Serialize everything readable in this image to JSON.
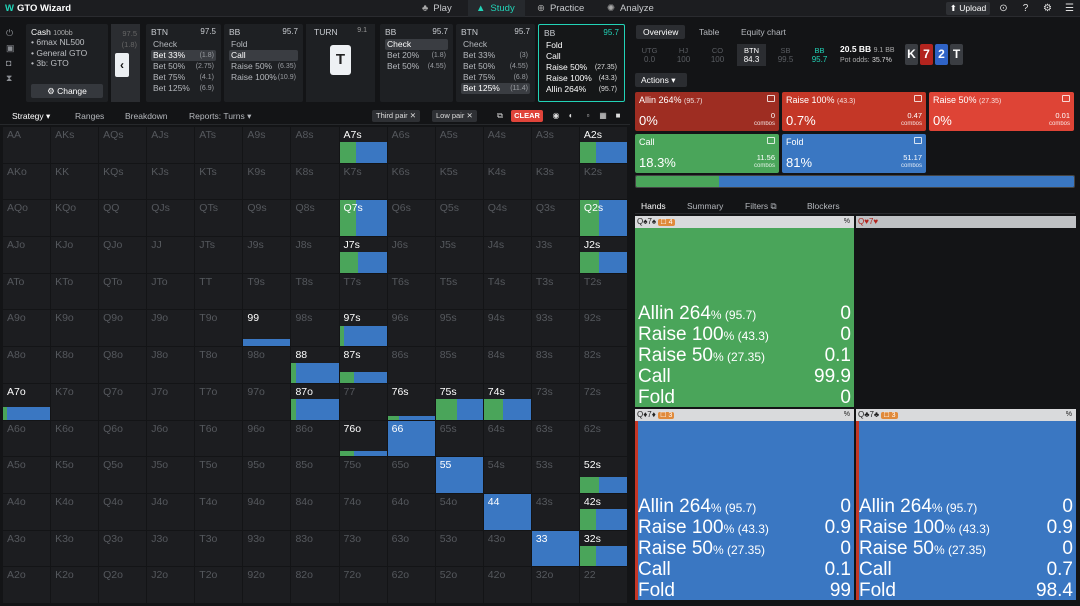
{
  "app": {
    "logo": "GTO Wizard",
    "nav": [
      "Play",
      "Study",
      "Practice",
      "Analyze"
    ],
    "active_nav": "Study",
    "upload": "Upload"
  },
  "colors": {
    "green": "#4aa55a",
    "blue": "#3a77c2",
    "red_dark": "#9e2d22",
    "red": "#c43727",
    "red_bright": "#de4436",
    "accent": "#22d3b7"
  },
  "sidebar": {
    "icons": [
      "power-icon",
      "save-icon",
      "gamepad-icon",
      "hourglass-icon"
    ]
  },
  "cash": {
    "title": "Cash",
    "stake": "100bb",
    "items": [
      "6max NL500",
      "General GTO",
      "3b: GTO"
    ],
    "change": "Change"
  },
  "prev_node": {
    "value": "97.5",
    "sub": "(1.8)"
  },
  "nodes": [
    {
      "pos": "BTN",
      "stack": "97.5",
      "actions": [
        {
          "n": "Check",
          "s": ""
        },
        {
          "n": "Bet 33%",
          "s": "(1.8)",
          "sel": true
        },
        {
          "n": "Bet 50%",
          "s": "(2.75)"
        },
        {
          "n": "Bet 75%",
          "s": "(4.1)"
        },
        {
          "n": "Bet 125%",
          "s": "(6.9)"
        }
      ]
    },
    {
      "pos": "BB",
      "stack": "95.7",
      "actions": [
        {
          "n": "Fold",
          "s": ""
        },
        {
          "n": "Call",
          "s": "",
          "sel": true
        },
        {
          "n": "Raise 50%",
          "s": "(6.35)"
        },
        {
          "n": "Raise 100%",
          "s": "(10.9)"
        }
      ]
    },
    {
      "pos": "BB",
      "stack": "95.7",
      "actions": [
        {
          "n": "Check",
          "s": "",
          "sel": true
        },
        {
          "n": "Bet 20%",
          "s": "(1.8)"
        },
        {
          "n": "Bet 50%",
          "s": "(4.55)"
        }
      ]
    },
    {
      "pos": "BTN",
      "stack": "95.7",
      "actions": [
        {
          "n": "Check",
          "s": ""
        },
        {
          "n": "Bet 33%",
          "s": "(3)"
        },
        {
          "n": "Bet 50%",
          "s": "(4.55)"
        },
        {
          "n": "Bet 75%",
          "s": "(6.8)"
        },
        {
          "n": "Bet 125%",
          "s": "(11.4)",
          "sel": true
        }
      ]
    },
    {
      "pos": "BB",
      "stack": "95.7",
      "active": true,
      "actions": [
        {
          "n": "Fold",
          "s": ""
        },
        {
          "n": "Call",
          "s": ""
        },
        {
          "n": "Raise 50%",
          "s": "(27.35)"
        },
        {
          "n": "Raise 100%",
          "s": "(43.3)"
        },
        {
          "n": "Allin 264%",
          "s": "(95.7)"
        }
      ]
    }
  ],
  "turn": {
    "label": "TURN",
    "value": "9.1",
    "card": "T"
  },
  "subtabs": [
    "Strategy",
    "Ranges",
    "Breakdown",
    "Reports: Turns"
  ],
  "filters": [
    "Third pair",
    "Low pair"
  ],
  "clear": "CLEAR",
  "matrix": {
    "labels": [
      [
        "AA",
        "AKs",
        "AQs",
        "AJs",
        "ATs",
        "A9s",
        "A8s",
        "A7s",
        "A6s",
        "A5s",
        "A4s",
        "A3s",
        "A2s"
      ],
      [
        "AKo",
        "KK",
        "KQs",
        "KJs",
        "KTs",
        "K9s",
        "K8s",
        "K7s",
        "K6s",
        "K5s",
        "K4s",
        "K3s",
        "K2s"
      ],
      [
        "AQo",
        "KQo",
        "QQ",
        "QJs",
        "QTs",
        "Q9s",
        "Q8s",
        "Q7s",
        "Q6s",
        "Q5s",
        "Q4s",
        "Q3s",
        "Q2s"
      ],
      [
        "AJo",
        "KJo",
        "QJo",
        "JJ",
        "JTs",
        "J9s",
        "J8s",
        "J7s",
        "J6s",
        "J5s",
        "J4s",
        "J3s",
        "J2s"
      ],
      [
        "ATo",
        "KTo",
        "QTo",
        "JTo",
        "TT",
        "T9s",
        "T8s",
        "T7s",
        "T6s",
        "T5s",
        "T4s",
        "T3s",
        "T2s"
      ],
      [
        "A9o",
        "K9o",
        "Q9o",
        "J9o",
        "T9o",
        "99",
        "98s",
        "97s",
        "96s",
        "95s",
        "94s",
        "93s",
        "92s"
      ],
      [
        "A8o",
        "K8o",
        "Q8o",
        "J8o",
        "T8o",
        "98o",
        "88",
        "87s",
        "86s",
        "85s",
        "84s",
        "83s",
        "82s"
      ],
      [
        "A7o",
        "K7o",
        "Q7o",
        "J7o",
        "T7o",
        "97o",
        "87o",
        "77",
        "76s",
        "75s",
        "74s",
        "73s",
        "72s"
      ],
      [
        "A6o",
        "K6o",
        "Q6o",
        "J6o",
        "T6o",
        "96o",
        "86o",
        "76o",
        "66",
        "65s",
        "64s",
        "63s",
        "62s"
      ],
      [
        "A5o",
        "K5o",
        "Q5o",
        "J5o",
        "T5o",
        "95o",
        "85o",
        "75o",
        "65o",
        "55",
        "54s",
        "53s",
        "52s"
      ],
      [
        "A4o",
        "K4o",
        "Q4o",
        "J4o",
        "T4o",
        "94o",
        "84o",
        "74o",
        "64o",
        "54o",
        "44",
        "43s",
        "42s"
      ],
      [
        "A3o",
        "K3o",
        "Q3o",
        "J3o",
        "T3o",
        "93o",
        "83o",
        "73o",
        "63o",
        "53o",
        "43o",
        "33",
        "32s"
      ],
      [
        "A2o",
        "K2o",
        "Q2o",
        "J2o",
        "T2o",
        "92o",
        "82o",
        "72o",
        "62o",
        "52o",
        "42o",
        "32o",
        "22"
      ]
    ],
    "bars": [
      {
        "r": 0,
        "c": 7,
        "g": 0.35,
        "b": 0.65
      },
      {
        "r": 0,
        "c": 12,
        "g": 0.35,
        "b": 0.65
      },
      {
        "r": 2,
        "c": 7,
        "g": 0.35,
        "b": 0.65,
        "full": true
      },
      {
        "r": 2,
        "c": 12,
        "g": 0.4,
        "b": 0.6,
        "full": true
      },
      {
        "r": 3,
        "c": 7,
        "g": 0.4,
        "b": 0.6
      },
      {
        "r": 3,
        "c": 12,
        "g": 0.4,
        "b": 0.6
      },
      {
        "r": 5,
        "c": 5,
        "g": 0,
        "b": 1,
        "h": 0.2
      },
      {
        "r": 5,
        "c": 7,
        "g": 0.1,
        "b": 0.9
      },
      {
        "r": 6,
        "c": 6,
        "g": 0.1,
        "b": 0.9
      },
      {
        "r": 6,
        "c": 7,
        "g": 0.3,
        "b": 0.7,
        "h": 0.3
      },
      {
        "r": 7,
        "c": 0,
        "g": 0.08,
        "b": 0.92,
        "h": 0.35
      },
      {
        "r": 7,
        "c": 6,
        "g": 0.1,
        "b": 0.9
      },
      {
        "r": 7,
        "c": 8,
        "g": 0.25,
        "b": 0.75,
        "h": 0.1
      },
      {
        "r": 7,
        "c": 9,
        "g": 0.45,
        "b": 0.55
      },
      {
        "r": 7,
        "c": 10,
        "g": 0.4,
        "b": 0.6
      },
      {
        "r": 8,
        "c": 7,
        "g": 0.3,
        "b": 0.7,
        "h": 0.15
      },
      {
        "r": 8,
        "c": 8,
        "g": 0,
        "b": 1,
        "full": true
      },
      {
        "r": 9,
        "c": 9,
        "g": 0,
        "b": 1,
        "full": true
      },
      {
        "r": 9,
        "c": 12,
        "g": 0.4,
        "b": 0.6,
        "h": 0.45
      },
      {
        "r": 10,
        "c": 10,
        "g": 0,
        "b": 1,
        "full": true
      },
      {
        "r": 10,
        "c": 12,
        "g": 0.35,
        "b": 0.65
      },
      {
        "r": 11,
        "c": 11,
        "g": 0,
        "b": 1,
        "full": true
      },
      {
        "r": 11,
        "c": 12,
        "g": 0.35,
        "b": 0.65
      }
    ],
    "highlight": [
      [
        0,
        7
      ],
      [
        0,
        12
      ],
      [
        2,
        7
      ],
      [
        2,
        12
      ],
      [
        3,
        7
      ],
      [
        3,
        12
      ],
      [
        5,
        5
      ],
      [
        5,
        7
      ],
      [
        6,
        6
      ],
      [
        6,
        7
      ],
      [
        7,
        0
      ],
      [
        7,
        6
      ],
      [
        7,
        8
      ],
      [
        7,
        9
      ],
      [
        7,
        10
      ],
      [
        8,
        7
      ],
      [
        8,
        8
      ],
      [
        9,
        9
      ],
      [
        9,
        12
      ],
      [
        10,
        10
      ],
      [
        10,
        12
      ],
      [
        11,
        11
      ],
      [
        11,
        12
      ]
    ]
  },
  "right": {
    "tabs": [
      "Overview",
      "Table",
      "Equity chart"
    ],
    "positions": [
      {
        "n": "UTG",
        "v": "0.0"
      },
      {
        "n": "HJ",
        "v": "100"
      },
      {
        "n": "CO",
        "v": "100"
      },
      {
        "n": "BTN",
        "v": "84.3"
      },
      {
        "n": "SB",
        "v": "99.5"
      },
      {
        "n": "BB",
        "v": "95.7"
      }
    ],
    "pot": {
      "main": "20.5 BB",
      "side": "9.1 BB",
      "odds_label": "Pot odds:",
      "odds": "35.7%"
    },
    "board": [
      "K",
      "7",
      "2",
      "T"
    ],
    "actions_btn": "Actions",
    "cards": [
      {
        "n": "Allin 264%",
        "s": "(95.7)",
        "p": "0%",
        "c": "0"
      },
      {
        "n": "Raise 100%",
        "s": "(43.3)",
        "p": "0.7%",
        "c": "0.47"
      },
      {
        "n": "Raise 50%",
        "s": "(27.35)",
        "p": "0%",
        "c": "0.01"
      },
      {
        "n": "Call",
        "s": "",
        "p": "18.3%",
        "c": "11.56"
      },
      {
        "n": "Fold",
        "s": "",
        "p": "81%",
        "c": "51.17"
      }
    ],
    "combos_label": "combos",
    "freq": {
      "green": 0.19,
      "blue": 0.81
    },
    "hand_tabs": [
      "Hands",
      "Summary",
      "Filters",
      "Blockers"
    ],
    "hands": [
      {
        "name": "Q♠7♠",
        "bl": "4",
        "bl2": "4",
        "pct": "%",
        "color": "green",
        "vals": [
          {
            "n": "Allin 264",
            "s": "% (95.7)",
            "v": "0"
          },
          {
            "n": "Raise 100",
            "s": "% (43.3)",
            "v": "0"
          },
          {
            "n": "Raise 50",
            "s": "% (27.35)",
            "v": "0.1"
          },
          {
            "n": "Call",
            "s": "",
            "v": "99.9"
          },
          {
            "n": "Fold",
            "s": "",
            "v": "0"
          }
        ]
      },
      {
        "name": "Q♥7♥",
        "bl": "",
        "bl2": "",
        "pct": "",
        "color": "dark",
        "vals": []
      },
      {
        "name": "Q♦7♦",
        "bl": "3",
        "bl2": "3",
        "pct": "%",
        "color": "blue",
        "vals": [
          {
            "n": "Allin 264",
            "s": "% (95.7)",
            "v": "0"
          },
          {
            "n": "Raise 100",
            "s": "% (43.3)",
            "v": "0.9"
          },
          {
            "n": "Raise 50",
            "s": "% (27.35)",
            "v": "0"
          },
          {
            "n": "Call",
            "s": "",
            "v": "0.1"
          },
          {
            "n": "Fold",
            "s": "",
            "v": "99"
          }
        ]
      },
      {
        "name": "Q♣7♣",
        "bl": "3",
        "bl2": "3",
        "pct": "%",
        "color": "blue",
        "vals": [
          {
            "n": "Allin 264",
            "s": "% (95.7)",
            "v": "0"
          },
          {
            "n": "Raise 100",
            "s": "% (43.3)",
            "v": "0.9"
          },
          {
            "n": "Raise 50",
            "s": "% (27.35)",
            "v": "0"
          },
          {
            "n": "Call",
            "s": "",
            "v": "0.7"
          },
          {
            "n": "Fold",
            "s": "",
            "v": "98.4"
          }
        ]
      }
    ]
  }
}
